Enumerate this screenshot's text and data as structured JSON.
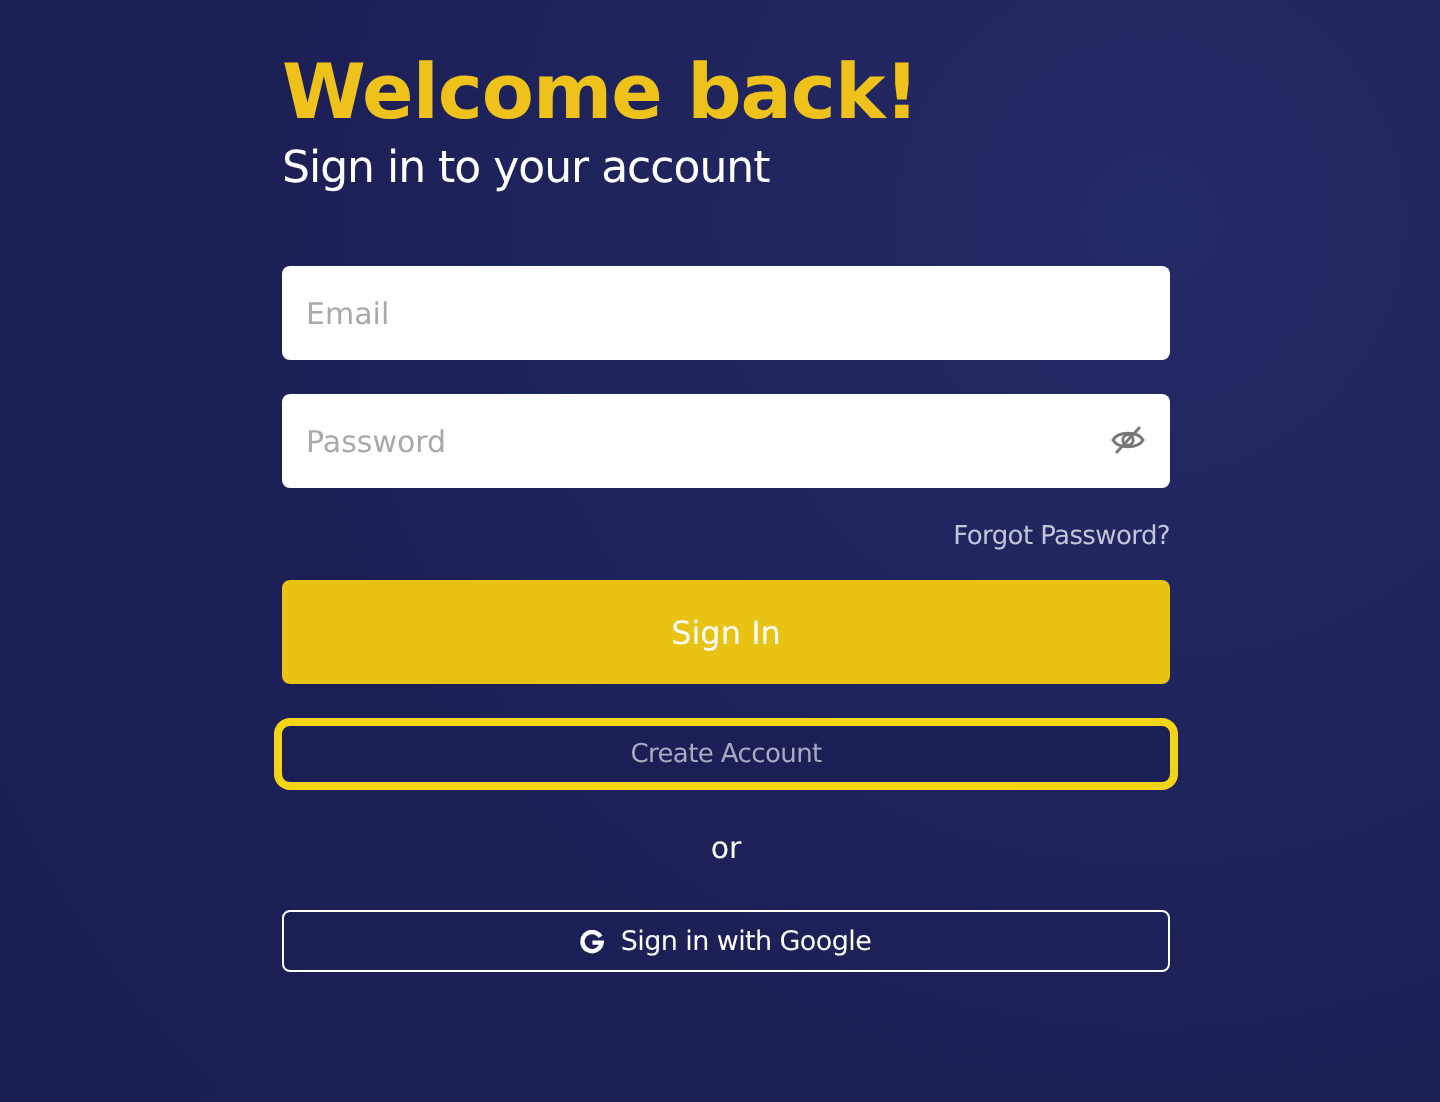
{
  "heading": "Welcome back!",
  "subheading": "Sign in to your account",
  "email_field": {
    "placeholder": "Email"
  },
  "password_field": {
    "placeholder": "Password",
    "password_visible": false
  },
  "forgot_password_link": "Forgot Password?",
  "sign_in_button": "Sign In",
  "create_account_button": {
    "label": "Create Account",
    "highlighted": true
  },
  "separator": "or",
  "google_button": "Sign in with Google"
}
